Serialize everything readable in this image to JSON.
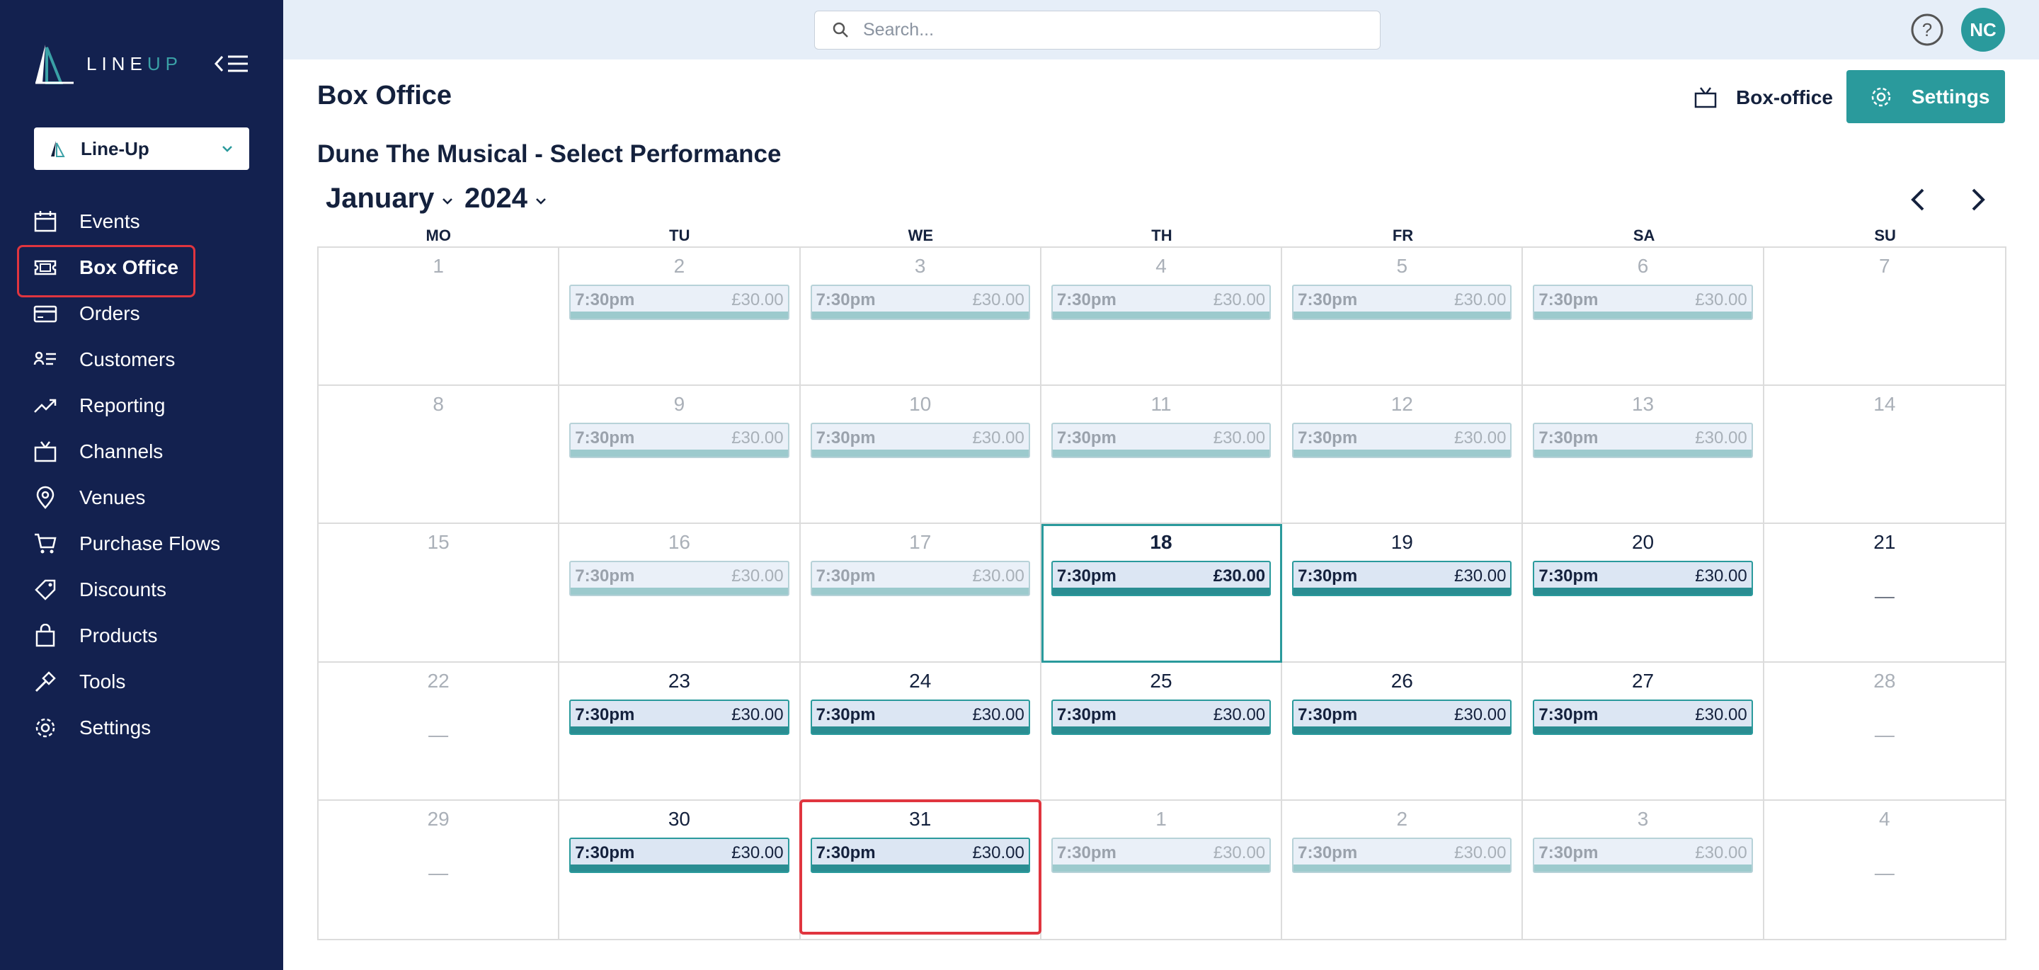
{
  "brand": {
    "name_line": "LINE",
    "name_up": "UP"
  },
  "org_selector": {
    "label": "Line-Up"
  },
  "sidebar": {
    "items": [
      {
        "label": "Events",
        "icon": "calendar-icon",
        "active": false
      },
      {
        "label": "Box Office",
        "icon": "ticket-icon",
        "active": true
      },
      {
        "label": "Orders",
        "icon": "credit-card-icon",
        "active": false
      },
      {
        "label": "Customers",
        "icon": "customers-list-icon",
        "active": false
      },
      {
        "label": "Reporting",
        "icon": "trend-chart-icon",
        "active": false
      },
      {
        "label": "Channels",
        "icon": "tv-icon",
        "active": false
      },
      {
        "label": "Venues",
        "icon": "map-pin-icon",
        "active": false
      },
      {
        "label": "Purchase Flows",
        "icon": "cart-icon",
        "active": false
      },
      {
        "label": "Discounts",
        "icon": "tag-icon",
        "active": false
      },
      {
        "label": "Products",
        "icon": "shopping-bag-icon",
        "active": false
      },
      {
        "label": "Tools",
        "icon": "hammer-icon",
        "active": false
      },
      {
        "label": "Settings",
        "icon": "gear-icon",
        "active": false
      }
    ]
  },
  "topbar": {
    "search_placeholder": "Search...",
    "avatar_initials": "NC"
  },
  "header": {
    "title": "Box Office",
    "boxoffice_label": "Box-office",
    "settings_label": "Settings"
  },
  "calendar": {
    "subtitle": "Dune The Musical - Select Performance",
    "month": "January",
    "year": "2024",
    "weekdays": [
      "MO",
      "TU",
      "WE",
      "TH",
      "FR",
      "SA",
      "SU"
    ],
    "colors": {
      "accent": "#2a9a9c",
      "sidebar": "#13214f",
      "highlight": "#e0353f"
    },
    "days": [
      {
        "day": "1",
        "current": false,
        "perf": null,
        "dash": false
      },
      {
        "day": "2",
        "current": false,
        "perf": {
          "time": "7:30pm",
          "price": "£30.00"
        }
      },
      {
        "day": "3",
        "current": false,
        "perf": {
          "time": "7:30pm",
          "price": "£30.00"
        }
      },
      {
        "day": "4",
        "current": false,
        "perf": {
          "time": "7:30pm",
          "price": "£30.00"
        }
      },
      {
        "day": "5",
        "current": false,
        "perf": {
          "time": "7:30pm",
          "price": "£30.00"
        }
      },
      {
        "day": "6",
        "current": false,
        "perf": {
          "time": "7:30pm",
          "price": "£30.00"
        }
      },
      {
        "day": "7",
        "current": false,
        "perf": null,
        "dash": false
      },
      {
        "day": "8",
        "current": false,
        "perf": null,
        "dash": false
      },
      {
        "day": "9",
        "current": false,
        "perf": {
          "time": "7:30pm",
          "price": "£30.00"
        }
      },
      {
        "day": "10",
        "current": false,
        "perf": {
          "time": "7:30pm",
          "price": "£30.00"
        }
      },
      {
        "day": "11",
        "current": false,
        "perf": {
          "time": "7:30pm",
          "price": "£30.00"
        }
      },
      {
        "day": "12",
        "current": false,
        "perf": {
          "time": "7:30pm",
          "price": "£30.00"
        }
      },
      {
        "day": "13",
        "current": false,
        "perf": {
          "time": "7:30pm",
          "price": "£30.00"
        }
      },
      {
        "day": "14",
        "current": false,
        "perf": null,
        "dash": false
      },
      {
        "day": "15",
        "current": false,
        "perf": null,
        "dash": false
      },
      {
        "day": "16",
        "current": false,
        "perf": {
          "time": "7:30pm",
          "price": "£30.00"
        }
      },
      {
        "day": "17",
        "current": false,
        "perf": {
          "time": "7:30pm",
          "price": "£30.00"
        }
      },
      {
        "day": "18",
        "current": true,
        "today": true,
        "perf": {
          "time": "7:30pm",
          "price": "£30.00"
        }
      },
      {
        "day": "19",
        "current": true,
        "perf": {
          "time": "7:30pm",
          "price": "£30.00"
        }
      },
      {
        "day": "20",
        "current": true,
        "perf": {
          "time": "7:30pm",
          "price": "£30.00"
        }
      },
      {
        "day": "21",
        "current": true,
        "perf": null,
        "dash": true
      },
      {
        "day": "22",
        "current": false,
        "perf": null,
        "dash": true
      },
      {
        "day": "23",
        "current": true,
        "perf": {
          "time": "7:30pm",
          "price": "£30.00"
        }
      },
      {
        "day": "24",
        "current": true,
        "perf": {
          "time": "7:30pm",
          "price": "£30.00"
        }
      },
      {
        "day": "25",
        "current": true,
        "perf": {
          "time": "7:30pm",
          "price": "£30.00"
        }
      },
      {
        "day": "26",
        "current": true,
        "perf": {
          "time": "7:30pm",
          "price": "£30.00"
        }
      },
      {
        "day": "27",
        "current": true,
        "perf": {
          "time": "7:30pm",
          "price": "£30.00"
        }
      },
      {
        "day": "28",
        "current": false,
        "perf": null,
        "dash": true
      },
      {
        "day": "29",
        "current": false,
        "perf": null,
        "dash": true
      },
      {
        "day": "30",
        "current": true,
        "perf": {
          "time": "7:30pm",
          "price": "£30.00"
        }
      },
      {
        "day": "31",
        "current": true,
        "highlight": true,
        "perf": {
          "time": "7:30pm",
          "price": "£30.00"
        }
      },
      {
        "day": "1",
        "current": false,
        "perf": {
          "time": "7:30pm",
          "price": "£30.00"
        }
      },
      {
        "day": "2",
        "current": false,
        "perf": {
          "time": "7:30pm",
          "price": "£30.00"
        }
      },
      {
        "day": "3",
        "current": false,
        "perf": {
          "time": "7:30pm",
          "price": "£30.00"
        }
      },
      {
        "day": "4",
        "current": false,
        "perf": null,
        "dash": true
      }
    ]
  }
}
